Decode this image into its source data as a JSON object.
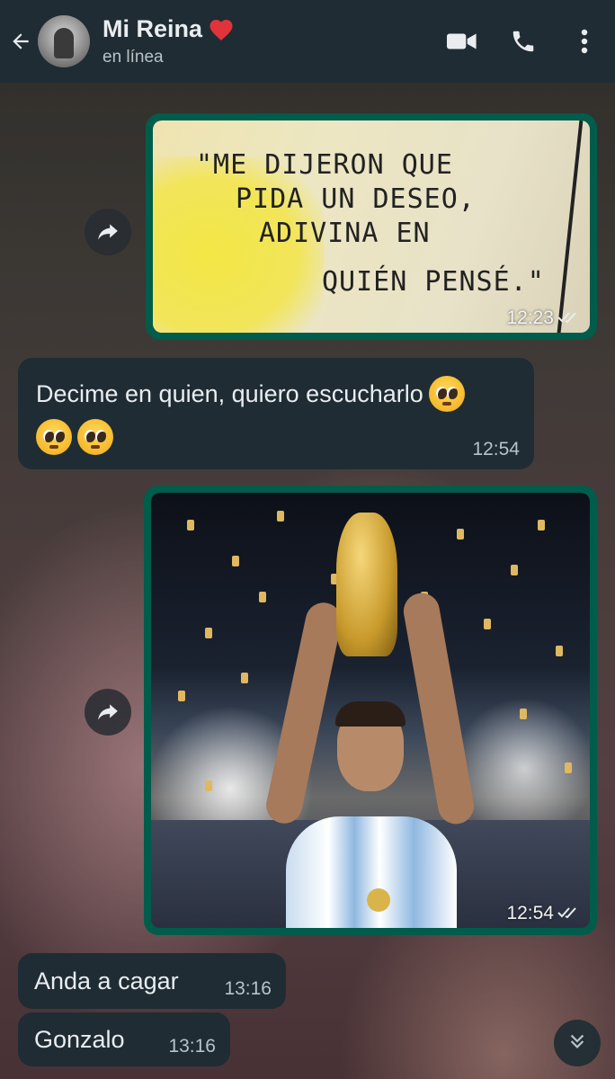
{
  "header": {
    "contact_name": "Mi Reina",
    "status": "en línea",
    "icons": [
      "back-arrow-icon",
      "avatar",
      "heart-icon",
      "video-call-icon",
      "phone-icon",
      "more-options-icon"
    ]
  },
  "messages": [
    {
      "type": "image-out",
      "image_text": [
        "\"ME DIJERON QUE",
        "PIDA UN DESEO,",
        "ADIVINA EN",
        "QUIÉN PENSÉ.\""
      ],
      "time": "12:23",
      "status_icon": "double-check-icon"
    },
    {
      "type": "text-in",
      "text": "Decime en quien, quiero escucharlo",
      "emoji_name": "pleading-face-emoji",
      "time": "12:54"
    },
    {
      "type": "image-out",
      "image_desc_icon": "trophy-photo",
      "time": "12:54",
      "status_icon": "double-check-icon"
    },
    {
      "type": "text-in",
      "text": "Anda a cagar",
      "time": "13:16"
    },
    {
      "type": "text-in",
      "text": "Gonzalo",
      "time": "13:16"
    }
  ],
  "colors": {
    "header_bg": "#1f2c34",
    "incoming_bubble": "#1f2c34",
    "outgoing_bubble": "#005c4b",
    "text_primary": "#e9edef",
    "text_secondary": "#b9c2c7"
  }
}
